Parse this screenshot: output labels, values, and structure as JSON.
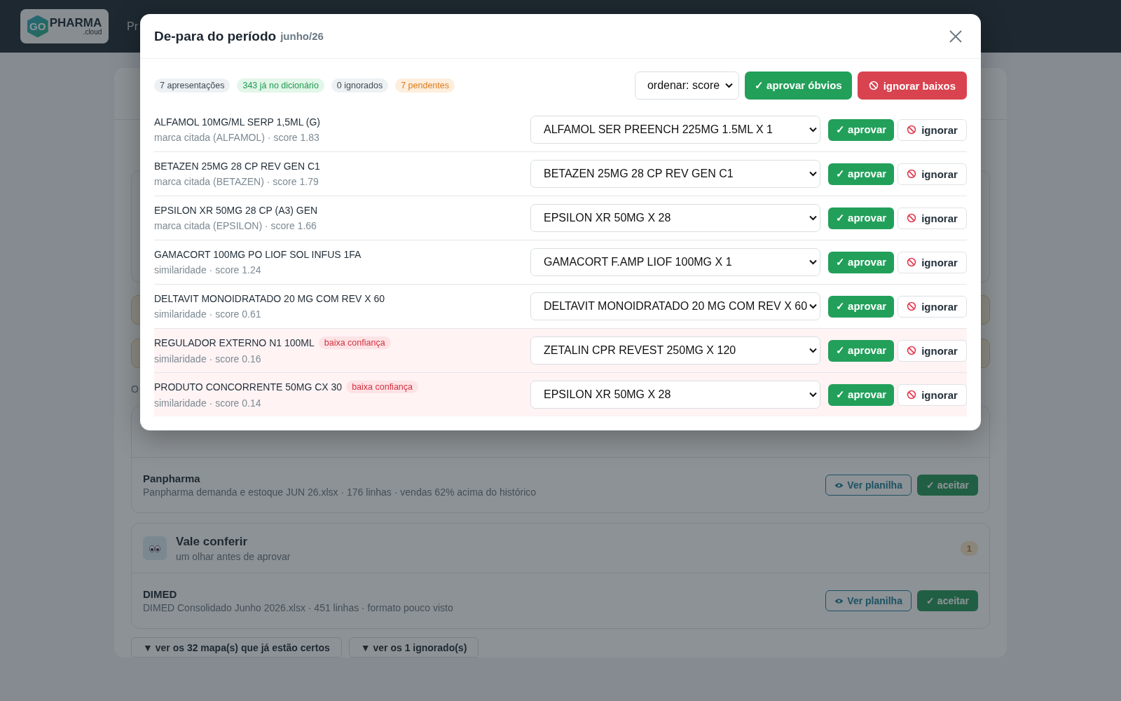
{
  "app_header": {
    "logo": {
      "mark": "GO",
      "name": "PHARMA",
      "suffix": ".cloud"
    },
    "nav_fragment": "Pr"
  },
  "background_page": {
    "group_label_fragment": "O",
    "suppliers": [
      {
        "name": "Panpharma",
        "details": "Panpharma demanda e estoque JUN 26.xlsx · 176 linhas · vendas 62% acima do histórico",
        "view_button": "Ver planilha",
        "accept_button": "✓ aceitar"
      }
    ],
    "review_group": {
      "title": "Vale conferir",
      "subtitle": "um olhar antes de aprovar",
      "count": "1",
      "items": [
        {
          "name": "DIMED",
          "details": "DIMED Consolidado Junho 2026.xlsx · 451 linhas · formato pouco visto",
          "view_button": "Ver planilha",
          "accept_button": "✓ aceitar"
        }
      ]
    },
    "toggles": [
      "▼ ver os 32 mapa(s) que já estão certos",
      "▼ ver os 1 ignorado(s)"
    ]
  },
  "modal": {
    "title": "De-para do período",
    "period": "junho/26",
    "stats": [
      {
        "label": "7 apresentações",
        "kind": "neutral"
      },
      {
        "label": "343 já no dicionário",
        "kind": "success"
      },
      {
        "label": "0 ignorados",
        "kind": "neutral"
      },
      {
        "label": "7 pendentes",
        "kind": "warning"
      }
    ],
    "sort": {
      "value": "ordenar: score"
    },
    "approve_all": "✓ aprovar óbvios",
    "ignore_low": "ignorar baixos",
    "rows": [
      {
        "product": "ALFAMOL 10MG/ML SERP 1,5ML (G)",
        "reason": "marca citada (ALFAMOL) · score 1.83",
        "low_confidence": false,
        "match": "ALFAMOL SER PREENCH 225MG 1.5ML X 1",
        "approve": "✓ aprovar",
        "ignore": "ignorar"
      },
      {
        "product": "BETAZEN 25MG 28 CP REV GEN C1",
        "reason": "marca citada (BETAZEN) · score 1.79",
        "low_confidence": false,
        "match": "BETAZEN 25MG 28 CP REV GEN C1",
        "approve": "✓ aprovar",
        "ignore": "ignorar"
      },
      {
        "product": "EPSILON XR 50MG 28 CP (A3) GEN",
        "reason": "marca citada (EPSILON) · score 1.66",
        "low_confidence": false,
        "match": "EPSILON XR 50MG X 28",
        "approve": "✓ aprovar",
        "ignore": "ignorar"
      },
      {
        "product": "GAMACORT 100MG PO LIOF SOL INFUS 1FA",
        "reason": "similaridade · score 1.24",
        "low_confidence": false,
        "match": "GAMACORT F.AMP LIOF 100MG X 1",
        "approve": "✓ aprovar",
        "ignore": "ignorar"
      },
      {
        "product": "DELTAVIT MONOIDRATADO 20 MG COM REV X 60",
        "reason": "similaridade · score 0.61",
        "low_confidence": false,
        "match": "DELTAVIT MONOIDRATADO 20 MG COM REV X 60",
        "approve": "✓ aprovar",
        "ignore": "ignorar"
      },
      {
        "product": "REGULADOR EXTERNO N1 100ML",
        "flag": "baixa confiança",
        "reason": "similaridade · score 0.16",
        "low_confidence": true,
        "match": "ZETALIN CPR REVEST 250MG X 120",
        "approve": "✓ aprovar",
        "ignore": "ignorar"
      },
      {
        "product": "PRODUTO CONCORRENTE 50MG CX 30",
        "flag": "baixa confiança",
        "reason": "similaridade · score 0.14",
        "low_confidence": true,
        "match": "EPSILON XR 50MG X 28",
        "approve": "✓ aprovar",
        "ignore": "ignorar"
      }
    ]
  }
}
